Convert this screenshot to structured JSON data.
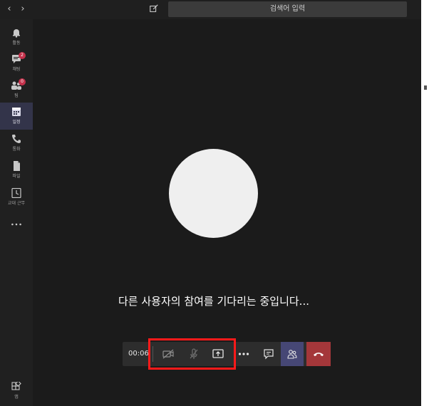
{
  "topbar": {
    "back_icon": "chevron-left-icon",
    "forward_icon": "chevron-right-icon",
    "compose_icon": "compose-icon",
    "search_placeholder": "검색어 입력"
  },
  "rail": {
    "items": [
      {
        "icon": "bell-icon",
        "label": "활동",
        "badge": ""
      },
      {
        "icon": "chat-icon",
        "label": "채팅",
        "badge": "2"
      },
      {
        "icon": "teams-icon",
        "label": "팀",
        "badge": "0"
      },
      {
        "icon": "calendar-icon",
        "label": "일정",
        "badge": ""
      },
      {
        "icon": "phone-icon",
        "label": "통화",
        "badge": ""
      },
      {
        "icon": "file-icon",
        "label": "파일",
        "badge": ""
      },
      {
        "icon": "clock-icon",
        "label": "교대 근무",
        "badge": ""
      }
    ],
    "more_icon": "ellipsis-icon",
    "apps_label": "앱",
    "apps_icon": "apps-icon"
  },
  "call": {
    "waiting_text": "다른 사용자의 참여를 기다리는 중입니다...",
    "timer": "00:06",
    "avatar_color": "#efefef"
  },
  "toolbar": {
    "camera_icon": "camera-off-icon",
    "mic_icon": "mic-off-icon",
    "share_icon": "share-screen-icon",
    "more_icon": "more-actions-icon",
    "chat_icon": "chat-bubble-icon",
    "people_icon": "participants-icon",
    "hangup_icon": "hang-up-icon"
  },
  "colors": {
    "highlight": "#ff1a1a",
    "hangup": "#a4373a",
    "people": "#464775",
    "active_rail": "#33344a"
  }
}
